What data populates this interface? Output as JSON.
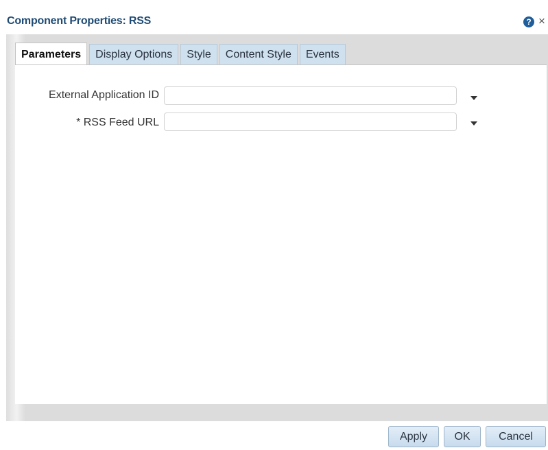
{
  "dialog": {
    "title": "Component Properties: RSS",
    "help_icon": "?",
    "close_icon": "×"
  },
  "tabs": [
    {
      "label": "Parameters",
      "active": true
    },
    {
      "label": "Display Options",
      "active": false
    },
    {
      "label": "Style",
      "active": false
    },
    {
      "label": "Content Style",
      "active": false
    },
    {
      "label": "Events",
      "active": false
    }
  ],
  "fields": {
    "external_app_id": {
      "label": "External Application ID",
      "value": ""
    },
    "rss_feed_url": {
      "label": "* RSS Feed URL",
      "value": ""
    }
  },
  "buttons": {
    "apply": "Apply",
    "ok": "OK",
    "cancel": "Cancel"
  },
  "colors": {
    "title": "#1f4b74",
    "accent": "#1f5d9b",
    "tab_inactive": "#cfe0ee",
    "panel_bg": "#d9d9d9"
  }
}
